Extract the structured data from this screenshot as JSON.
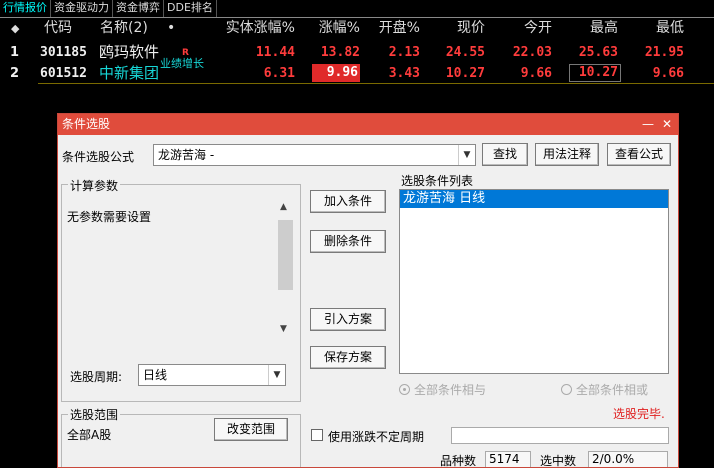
{
  "tabs": [
    "行情报价",
    "资金驱动力",
    "资金博弈",
    "DDE排名"
  ],
  "columns": {
    "marker": "◆",
    "code": "代码",
    "name": "名称(2)",
    "dot": "•",
    "body_change": "实体涨幅%",
    "change": "涨幅%",
    "open_pct": "开盘%",
    "price": "现价",
    "open": "今开",
    "high": "最高",
    "low": "最低"
  },
  "rows": [
    {
      "index": "1",
      "code": "301185",
      "name": "鸥玛软件",
      "badge": "R",
      "badge2": "",
      "body_change": "11.44",
      "change": "13.82",
      "open_pct": "2.13",
      "price": "24.55",
      "open": "22.03",
      "high": "25.63",
      "low": "21.95"
    },
    {
      "index": "2",
      "code": "601512",
      "name": "中新集团",
      "badge": "",
      "badge2": "业绩增长",
      "body_change": "6.31",
      "change": "9.96",
      "open_pct": "3.43",
      "price": "10.27",
      "open": "9.66",
      "high": "10.27",
      "low": "9.66"
    }
  ],
  "dialog": {
    "title": "条件选股",
    "minimize": "—",
    "close": "✕",
    "formula_label": "条件选股公式",
    "formula_value": "龙游苦海  -",
    "btn_find": "查找",
    "btn_usage": "用法注释",
    "btn_view": "查看公式",
    "params_title": "计算参数",
    "params_text": "无参数需要设置",
    "period_label": "选股周期:",
    "period_value": "日线",
    "btn_add": "加入条件",
    "btn_delete": "删除条件",
    "btn_import": "引入方案",
    "btn_save": "保存方案",
    "list_title": "选股条件列表",
    "list_items": [
      "龙游苦海  日线"
    ],
    "radio_and": "全部条件相与",
    "radio_or": "全部条件相或",
    "status": "选股完毕.",
    "range_title": "选股范围",
    "range_value": "全部A股",
    "btn_change_range": "改变范围",
    "checkbox_label": "使用涨跌不定周期",
    "count_label": "品种数",
    "count_value": "5174",
    "selected_label": "选中数",
    "selected_value": "2/0.0%"
  },
  "colors": {
    "up": "#ff3c3c",
    "accent": "#e04c3c",
    "selection": "#0078d7"
  }
}
